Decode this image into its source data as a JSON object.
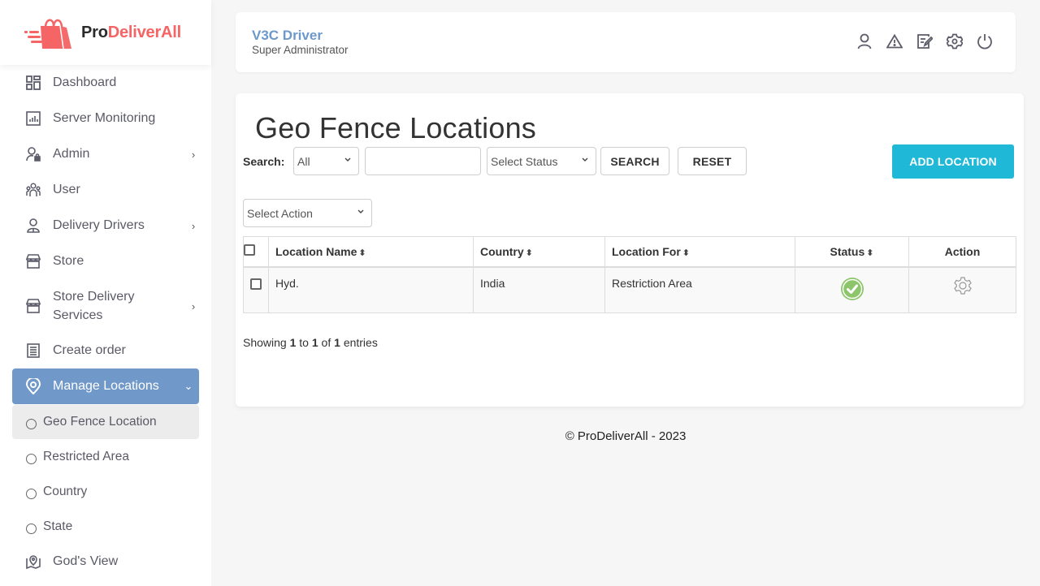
{
  "brand": {
    "pro": "Pro",
    "rest": "DeliverAll",
    "accent_color": "#f56565"
  },
  "sidebar": {
    "items": [
      {
        "label": "Dashboard",
        "icon": "dashboard-icon"
      },
      {
        "label": "Server Monitoring",
        "icon": "chart-icon"
      },
      {
        "label": "Admin",
        "icon": "admin-lock-icon",
        "has_children": true
      },
      {
        "label": "User",
        "icon": "users-icon"
      },
      {
        "label": "Delivery Drivers",
        "icon": "driver-icon",
        "has_children": true
      },
      {
        "label": "Store",
        "icon": "store-icon"
      },
      {
        "label": "Store Delivery Services",
        "label_line1": "Store Delivery",
        "label_line2": "Services",
        "icon": "store-icon",
        "has_children": true
      },
      {
        "label": "Create order",
        "icon": "document-icon"
      },
      {
        "label": "Manage Locations",
        "icon": "location-pin-icon",
        "expanded": true,
        "active": true
      },
      {
        "label": "God's View",
        "icon": "map-pin-icon"
      }
    ],
    "sub_items": [
      {
        "label": "Geo Fence Location",
        "selected": true
      },
      {
        "label": "Restricted Area"
      },
      {
        "label": "Country"
      },
      {
        "label": "State"
      }
    ],
    "active_color": "#7098c8"
  },
  "header": {
    "user_name": "V3C Driver",
    "user_role": "Super Administrator",
    "icons": [
      "user-icon",
      "alert-icon",
      "edit-icon",
      "settings-icon",
      "power-icon"
    ]
  },
  "main": {
    "title": "Geo Fence Locations",
    "search_label": "Search:",
    "search_field_select": "All",
    "search_input_value": "",
    "status_select": "Select Status",
    "search_button": "SEARCH",
    "reset_button": "RESET",
    "add_button": "ADD LOCATION",
    "add_button_color": "#1fb8d6",
    "action_select": "Select Action",
    "table": {
      "columns": [
        "Location Name",
        "Country",
        "Location For",
        "Status",
        "Action"
      ],
      "rows": [
        {
          "location_name": "Hyd.",
          "country": "India",
          "location_for": "Restriction Area",
          "status": "active",
          "action": "settings"
        }
      ]
    },
    "showing": {
      "prefix": "Showing",
      "from": "1",
      "to_word": "to",
      "to": "1",
      "of_word": "of",
      "total": "1",
      "suffix": "entries"
    }
  },
  "footer": {
    "text": "© ProDeliverAll - 2023"
  }
}
